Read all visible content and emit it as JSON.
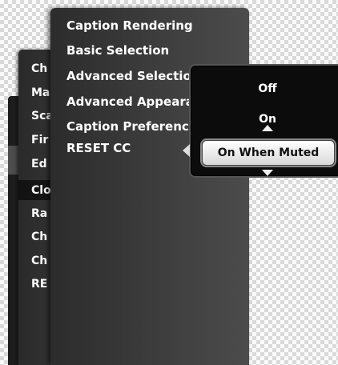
{
  "back_menu": {
    "items": [
      "Ch",
      "Ma",
      "Sca",
      "Fir",
      "Ed",
      "Clo",
      "Ra",
      "Ch",
      "Ch",
      "RE"
    ]
  },
  "front_menu": {
    "items": [
      "Caption Rendering",
      "Basic Selection",
      "Advanced Selection",
      "Advanced Appearance",
      "Caption Preference",
      "RESET CC"
    ]
  },
  "popup": {
    "options": [
      "Off",
      "On"
    ],
    "selected": "On When Muted"
  },
  "colors": {
    "menu_text": "#ffffff",
    "selected_bg": "#eeeeee"
  }
}
